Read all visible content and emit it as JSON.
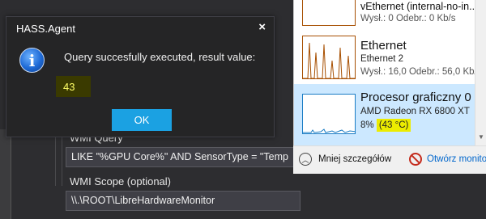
{
  "dialog": {
    "title": "HASS.Agent",
    "message": "Query succesfully executed, result value:",
    "result_value": "43",
    "ok_label": "OK"
  },
  "form": {
    "query_label": "WMI Query",
    "query_value": "LIKE \"%GPU Core%\" AND SensorType = \"Temp",
    "scope_label": "WMI Scope (optional)",
    "scope_value": "\\\\.\\ROOT\\LibreHardwareMonitor"
  },
  "task_manager": {
    "items": [
      {
        "title": "vEthernet (internal-no-in...",
        "stat": "Wysł.: 0 Odebr.: 0 Kb/s"
      },
      {
        "title": "Ethernet",
        "subtitle": "Ethernet 2",
        "stat": "Wysł.: 16,0 Odebr.: 56,0 Kb/"
      },
      {
        "title": "Procesor graficzny 0",
        "subtitle": "AMD Radeon RX 6800 XT",
        "usage": "8%",
        "temperature": "(43 °C)"
      }
    ],
    "fewer_details_label": "Mniej szczegółów",
    "open_monitor_label": "Otwórz monito"
  },
  "colors": {
    "dialog_bg": "#252526",
    "ok_button": "#1ba1e2",
    "result_highlight": "#ffff66",
    "selected_item": "#cce8ff",
    "temp_highlight": "#ecec00"
  }
}
